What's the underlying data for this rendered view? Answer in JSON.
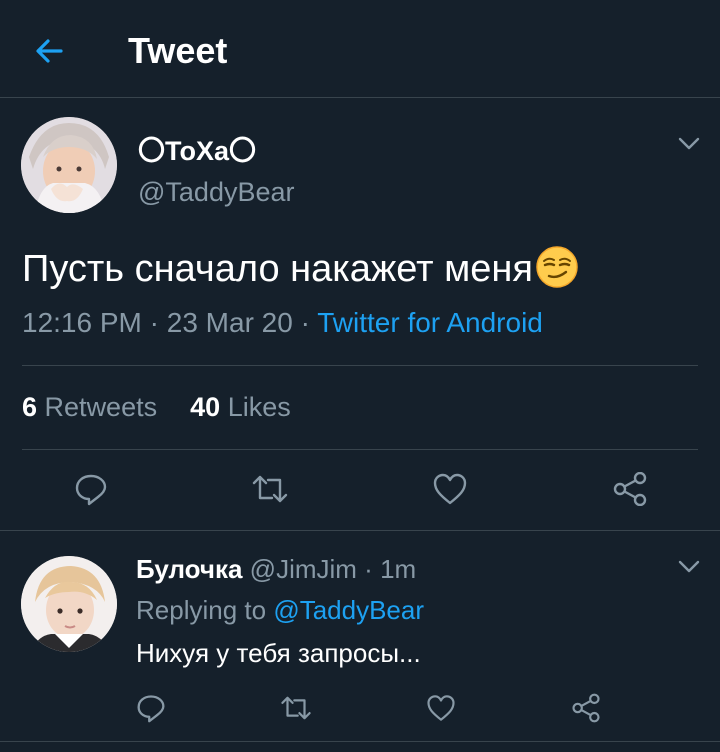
{
  "colors": {
    "background": "#15202b",
    "divider": "#38444d",
    "accent": "#1da1f2",
    "muted": "#8899a6",
    "text": "#ffffff"
  },
  "header": {
    "title": "Tweet",
    "back_icon": "arrow-left-icon"
  },
  "tweet": {
    "display_name": "〇ToXa〇",
    "handle": "@TaddyBear",
    "text": "Пусть сначало накажет меня",
    "emoji": "smirking-face",
    "time": "12:16 PM",
    "date": "23 Mar 20",
    "separator": "·",
    "source": "Twitter for Android",
    "retweets_count": "6",
    "retweets_label": "Retweets",
    "likes_count": "40",
    "likes_label": "Likes",
    "actions": [
      "reply-icon",
      "retweet-icon",
      "like-icon",
      "share-icon"
    ]
  },
  "reply": {
    "display_name": "Булочка",
    "handle": "@JimJim",
    "separator": "·",
    "time": "1m",
    "replying_prefix": "Replying to",
    "replying_to": "@TaddyBear",
    "text": "Нихуя у тебя запросы...",
    "actions": [
      "reply-icon",
      "retweet-icon",
      "like-icon",
      "share-icon"
    ]
  }
}
